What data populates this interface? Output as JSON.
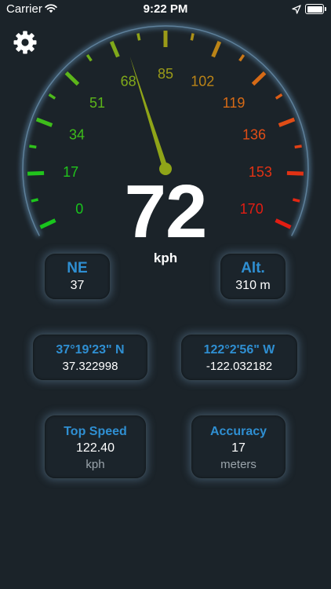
{
  "status_bar": {
    "carrier": "Carrier",
    "time": "9:22 PM",
    "wifi_icon": "wifi-icon",
    "location_icon": "location-arrow-icon",
    "battery_icon": "battery-full-icon"
  },
  "settings": {
    "icon": "gear-icon"
  },
  "gauge": {
    "min": 0,
    "max": 170,
    "needle_value": 72,
    "tick_labels": [
      {
        "value": 0,
        "label": "0",
        "color": "#19c51d"
      },
      {
        "value": 17,
        "label": "17",
        "color": "#21c41c"
      },
      {
        "value": 34,
        "label": "34",
        "color": "#3ebd1b"
      },
      {
        "value": 51,
        "label": "51",
        "color": "#5cb51a"
      },
      {
        "value": 68,
        "label": "68",
        "color": "#80a91a"
      },
      {
        "value": 85,
        "label": "85",
        "color": "#9b9b18"
      },
      {
        "value": 102,
        "label": "102",
        "color": "#bb8417"
      },
      {
        "value": 119,
        "label": "119",
        "color": "#d66a16"
      },
      {
        "value": 136,
        "label": "136",
        "color": "#e04d16"
      },
      {
        "value": 153,
        "label": "153",
        "color": "#e23214"
      },
      {
        "value": 170,
        "label": "170",
        "color": "#e21d13"
      }
    ],
    "needle_color": "#8fa418",
    "rim_color": "#5c86a8"
  },
  "speed": {
    "value": "72",
    "unit": "kph"
  },
  "heading": {
    "label": "NE",
    "value": "37"
  },
  "altitude": {
    "label": "Alt.",
    "value": "310 m"
  },
  "latitude": {
    "dms": "37°19'23\" N",
    "decimal": "37.322998"
  },
  "longitude": {
    "dms": "122°2'56\" W",
    "decimal": "-122.032182"
  },
  "top_speed": {
    "label": "Top Speed",
    "value": "122.40",
    "unit": "kph"
  },
  "accuracy": {
    "label": "Accuracy",
    "value": "17",
    "unit": "meters"
  }
}
